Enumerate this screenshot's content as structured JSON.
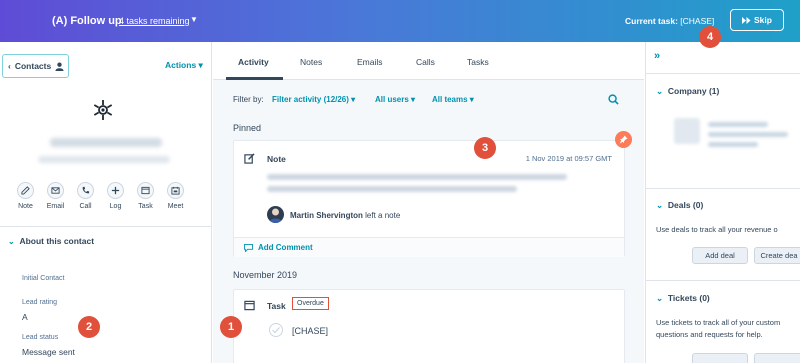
{
  "topbar": {
    "title": "(A) Follow up",
    "remaining": "4 tasks remaining",
    "current_label": "Current task:",
    "current_value": "[CHASE]",
    "skip_label": "Skip"
  },
  "badges": [
    "1",
    "2",
    "3",
    "4"
  ],
  "left": {
    "contacts_label": "Contacts",
    "actions_label": "Actions",
    "quick_actions": [
      "Note",
      "Email",
      "Call",
      "Log",
      "Task",
      "Meet"
    ],
    "about_title": "About this contact",
    "props": [
      {
        "label": "Initial Contact",
        "value": ""
      },
      {
        "label": "Lead rating",
        "value": "A"
      },
      {
        "label": "Lead status",
        "value": "Message sent"
      }
    ]
  },
  "center": {
    "tabs": [
      "Activity",
      "Notes",
      "Emails",
      "Calls",
      "Tasks"
    ],
    "filter_by": "Filter by:",
    "filter_activity": "Filter activity (12/26)",
    "filter_users": "All users",
    "filter_teams": "All teams",
    "pinned_label": "Pinned",
    "note": {
      "title": "Note",
      "date": "1 Nov 2019 at 09:57 GMT",
      "author": "Martin Shervington",
      "author_suffix": "left a note",
      "add_comment": "Add Comment"
    },
    "month_label": "November 2019",
    "task": {
      "title": "Task",
      "status": "Overdue",
      "name": "[CHASE]"
    }
  },
  "right": {
    "company_head": "Company (1)",
    "deals_head": "Deals (0)",
    "deals_text": "Use deals to track all your revenue o",
    "add_deal": "Add deal",
    "create_deal": "Create dea",
    "tickets_head": "Tickets (0)",
    "tickets_text_1": "Use tickets to track all of your custom",
    "tickets_text_2": "questions and requests for help."
  },
  "colors": {
    "accent": "#0091ae",
    "badge": "#e0503a",
    "pin": "#ff7a59",
    "header_start": "#5f4cd6",
    "header_end": "#1fa0c9"
  }
}
